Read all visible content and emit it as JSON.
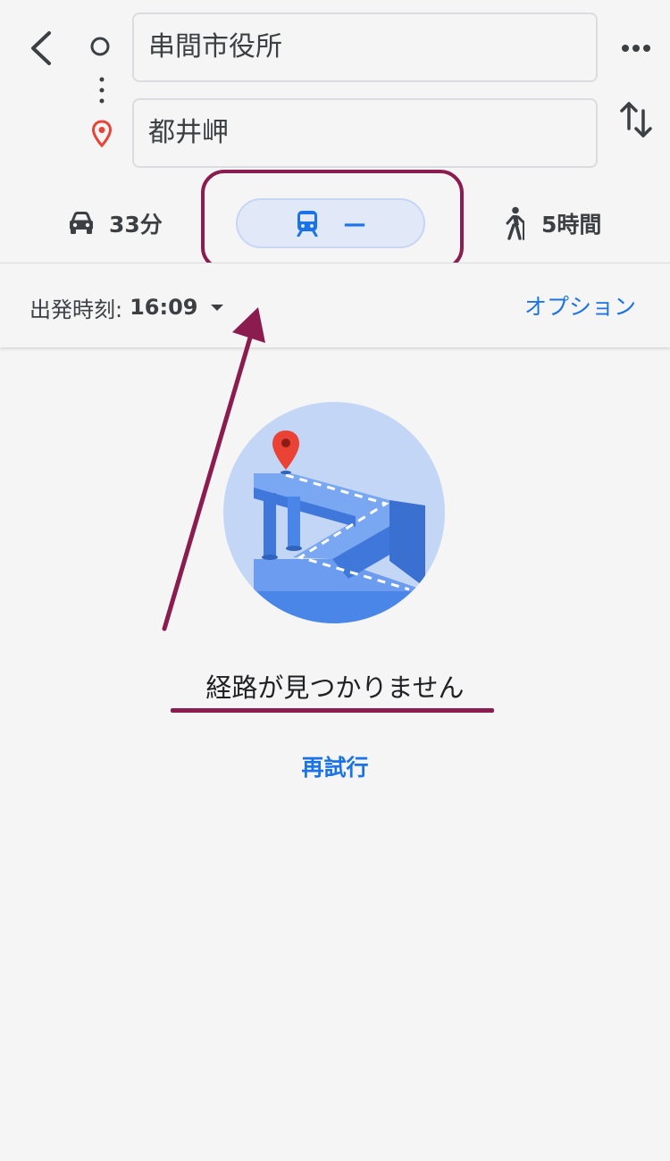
{
  "route": {
    "origin": "串間市役所",
    "destination": "都井岬"
  },
  "modes": {
    "drive": {
      "icon": "car-icon",
      "label": "33分"
    },
    "transit": {
      "icon": "train-icon",
      "label": "—"
    },
    "walk": {
      "icon": "walking-person-icon",
      "label": "5時間"
    }
  },
  "depart": {
    "label": "出発時刻:",
    "time": "16:09",
    "options_label": "オプション"
  },
  "result": {
    "message": "経路が見つかりません",
    "retry_label": "再試行"
  },
  "icons": {
    "back": "chevron-left-icon",
    "more": "more-horizontal-icon",
    "swap": "swap-vertical-icon",
    "origin": "origin-circle-icon",
    "destination": "location-pin-icon"
  },
  "colors": {
    "accent": "#1a73e8",
    "annotation": "#8a1c4f",
    "pin_red": "#ea4335",
    "transit_pill_bg": "#e1e9f9"
  }
}
